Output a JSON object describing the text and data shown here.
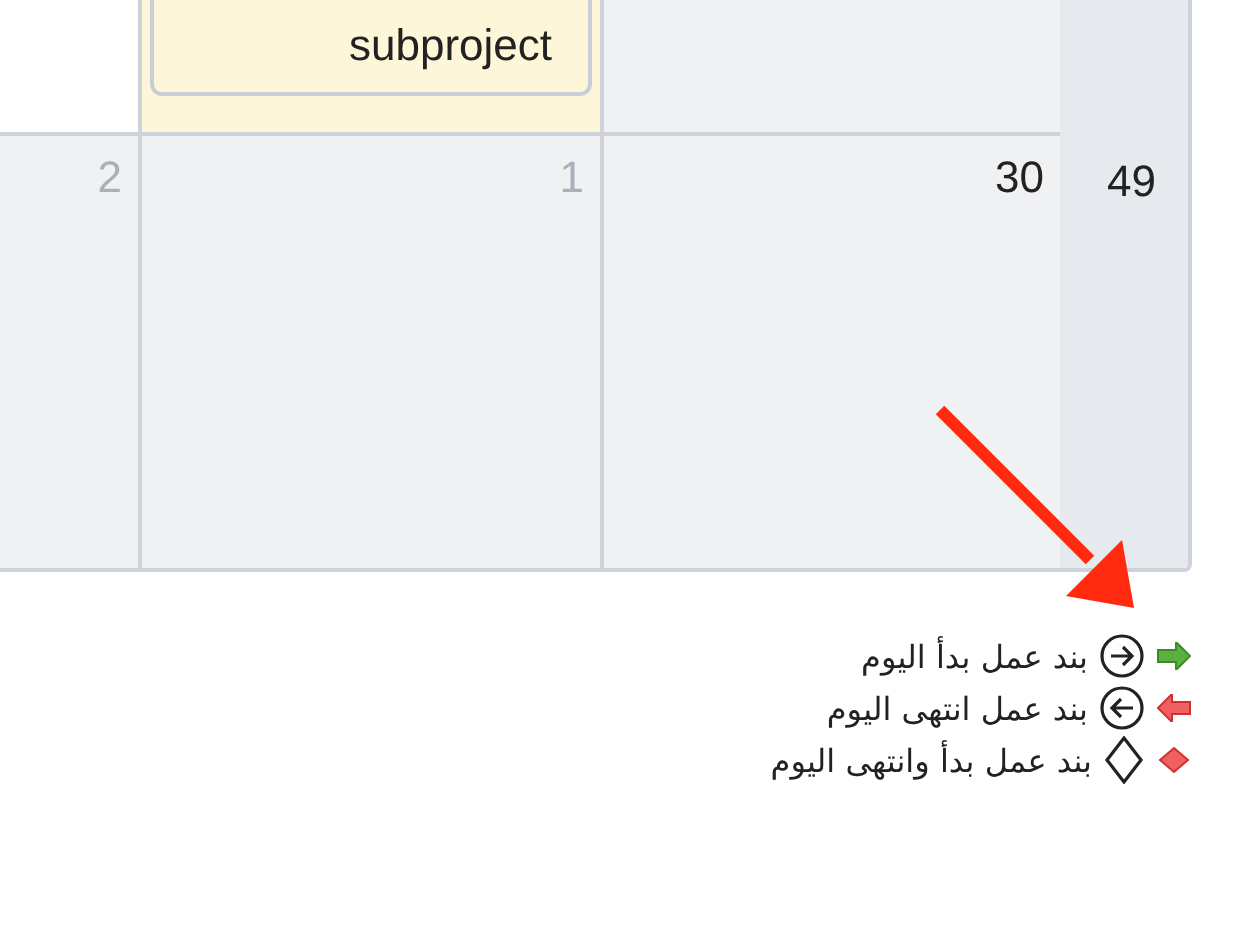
{
  "calendar": {
    "event": {
      "title": "subproject"
    },
    "days": [
      {
        "number": "30",
        "other_month": false
      },
      {
        "number": "1",
        "other_month": true
      },
      {
        "number": "2",
        "other_month": true
      }
    ],
    "week_number": "49"
  },
  "legend": [
    {
      "kind": "start",
      "label": "بند عمل بدأ اليوم"
    },
    {
      "kind": "end",
      "label": "بند عمل انتهى اليوم"
    },
    {
      "kind": "both",
      "label": "بند عمل بدأ وانتهى اليوم"
    }
  ]
}
